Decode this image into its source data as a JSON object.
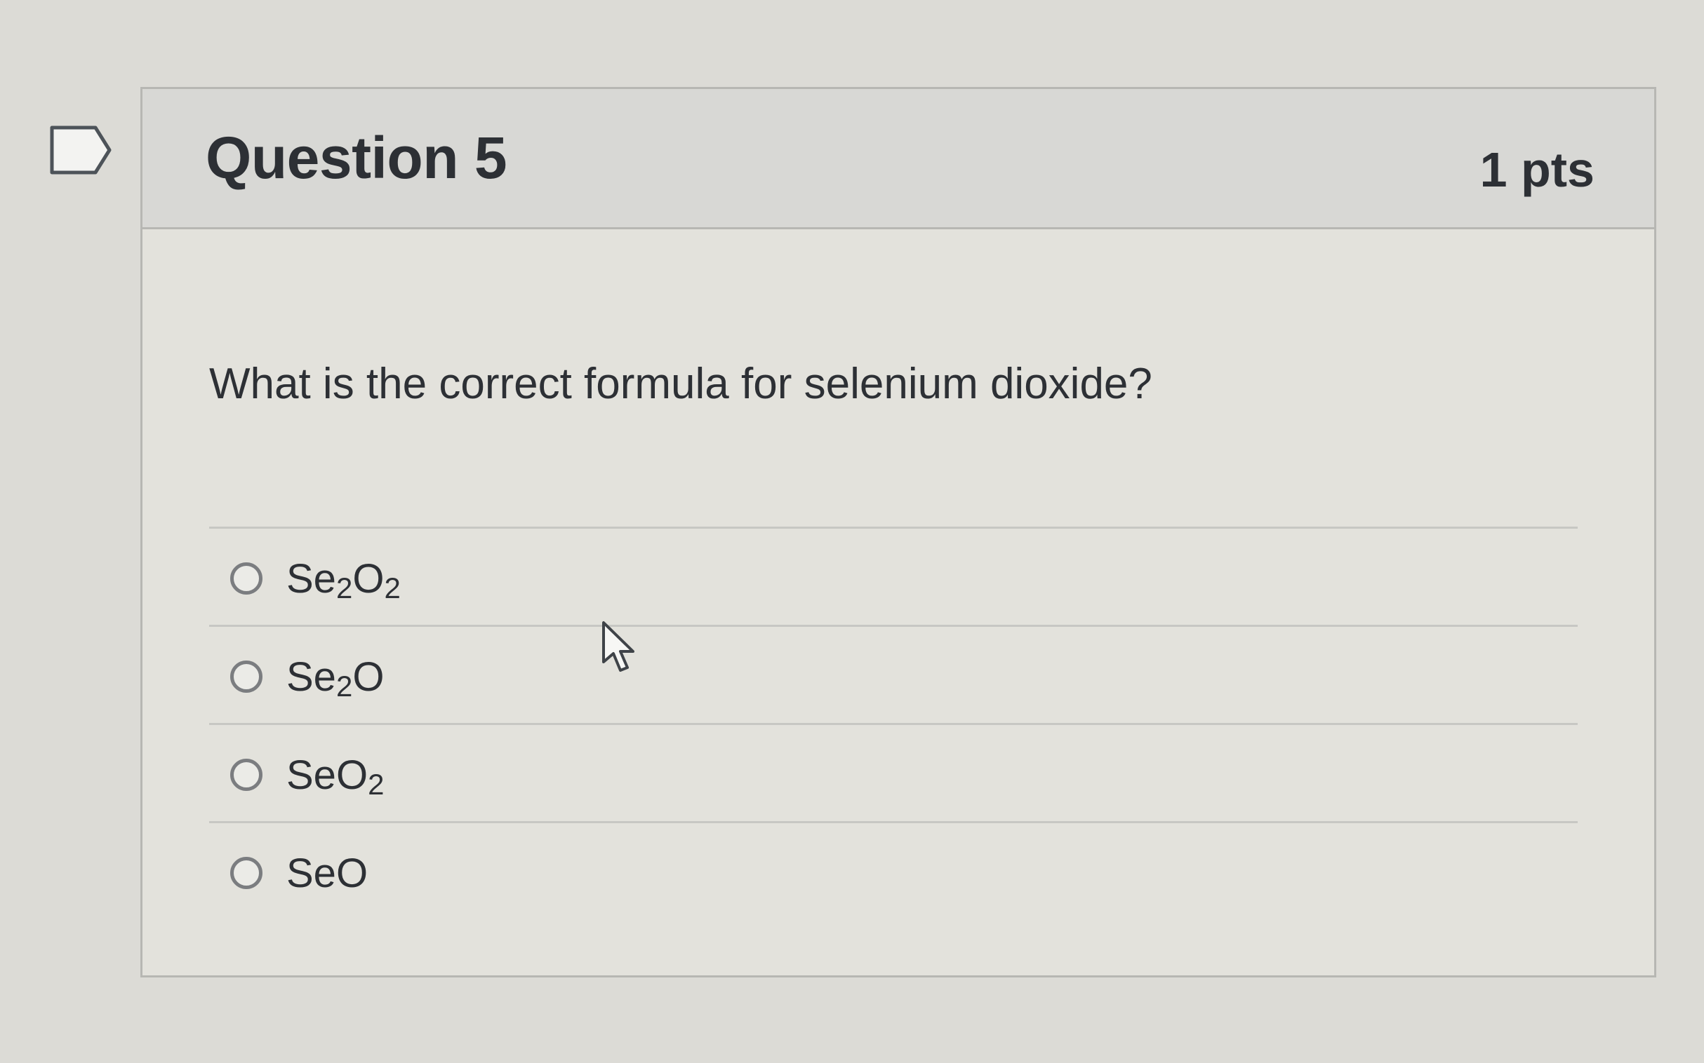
{
  "question": {
    "title": "Question 5",
    "points": "1 pts",
    "text": "What is the correct formula for selenium dioxide?",
    "answers": [
      {
        "parts": [
          "Se",
          "2",
          "O",
          "2"
        ]
      },
      {
        "parts": [
          "Se",
          "2",
          "O",
          ""
        ]
      },
      {
        "parts": [
          "SeO",
          "2",
          "",
          ""
        ]
      },
      {
        "parts": [
          "SeO",
          "",
          "",
          ""
        ]
      }
    ]
  },
  "icons": {
    "flag": "flag-outline-icon",
    "radio": "radio-unselected-icon",
    "cursor": "mouse-pointer-icon"
  },
  "colors": {
    "background": "#dcdbd6",
    "header": "#d8d8d5",
    "text": "#2d3035",
    "border": "#b7b7b3"
  }
}
